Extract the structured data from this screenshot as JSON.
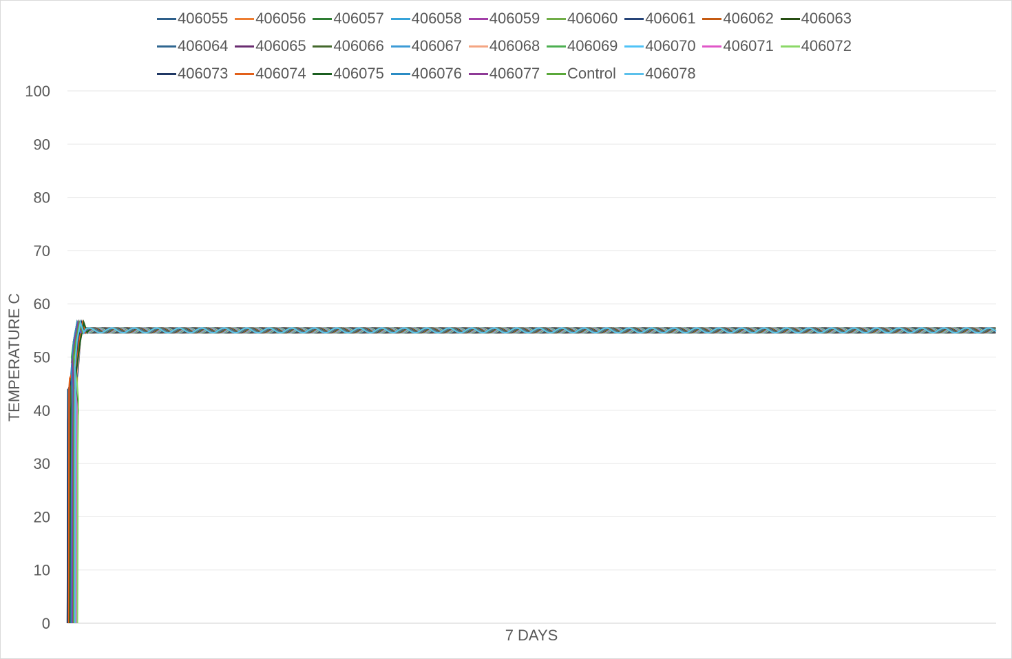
{
  "chart_data": {
    "type": "line",
    "title": "",
    "xlabel": "7 DAYS",
    "ylabel": "TEMPERATURE C",
    "ylim": [
      0,
      100
    ],
    "yticks": [
      "0",
      "10",
      "20",
      "30",
      "40",
      "50",
      "60",
      "70",
      "80",
      "90",
      "100"
    ],
    "grid": true,
    "legend_position": "top",
    "steady_state_value": 55,
    "series": [
      {
        "name": "406055",
        "color": "#2e5f8a"
      },
      {
        "name": "406056",
        "color": "#ed7d31"
      },
      {
        "name": "406057",
        "color": "#2e7d32"
      },
      {
        "name": "406058",
        "color": "#36a3d9"
      },
      {
        "name": "406059",
        "color": "#a23fa8"
      },
      {
        "name": "406060",
        "color": "#70ad47"
      },
      {
        "name": "406061",
        "color": "#264478"
      },
      {
        "name": "406062",
        "color": "#c55a11"
      },
      {
        "name": "406063",
        "color": "#274e13"
      },
      {
        "name": "406064",
        "color": "#2f6690"
      },
      {
        "name": "406065",
        "color": "#6a2c70"
      },
      {
        "name": "406066",
        "color": "#43682b"
      },
      {
        "name": "406067",
        "color": "#3c9bd6"
      },
      {
        "name": "406068",
        "color": "#f4a582"
      },
      {
        "name": "406069",
        "color": "#4caf50"
      },
      {
        "name": "406070",
        "color": "#4fc3f7"
      },
      {
        "name": "406071",
        "color": "#e056c8"
      },
      {
        "name": "406072",
        "color": "#8bd867"
      },
      {
        "name": "406073",
        "color": "#203864"
      },
      {
        "name": "406074",
        "color": "#e2601a"
      },
      {
        "name": "406075",
        "color": "#1b5e20"
      },
      {
        "name": "406076",
        "color": "#2b8cc4"
      },
      {
        "name": "406077",
        "color": "#8e3a96"
      },
      {
        "name": "Control",
        "color": "#5aa83a"
      },
      {
        "name": "406078",
        "color": "#5bc0eb"
      }
    ]
  }
}
